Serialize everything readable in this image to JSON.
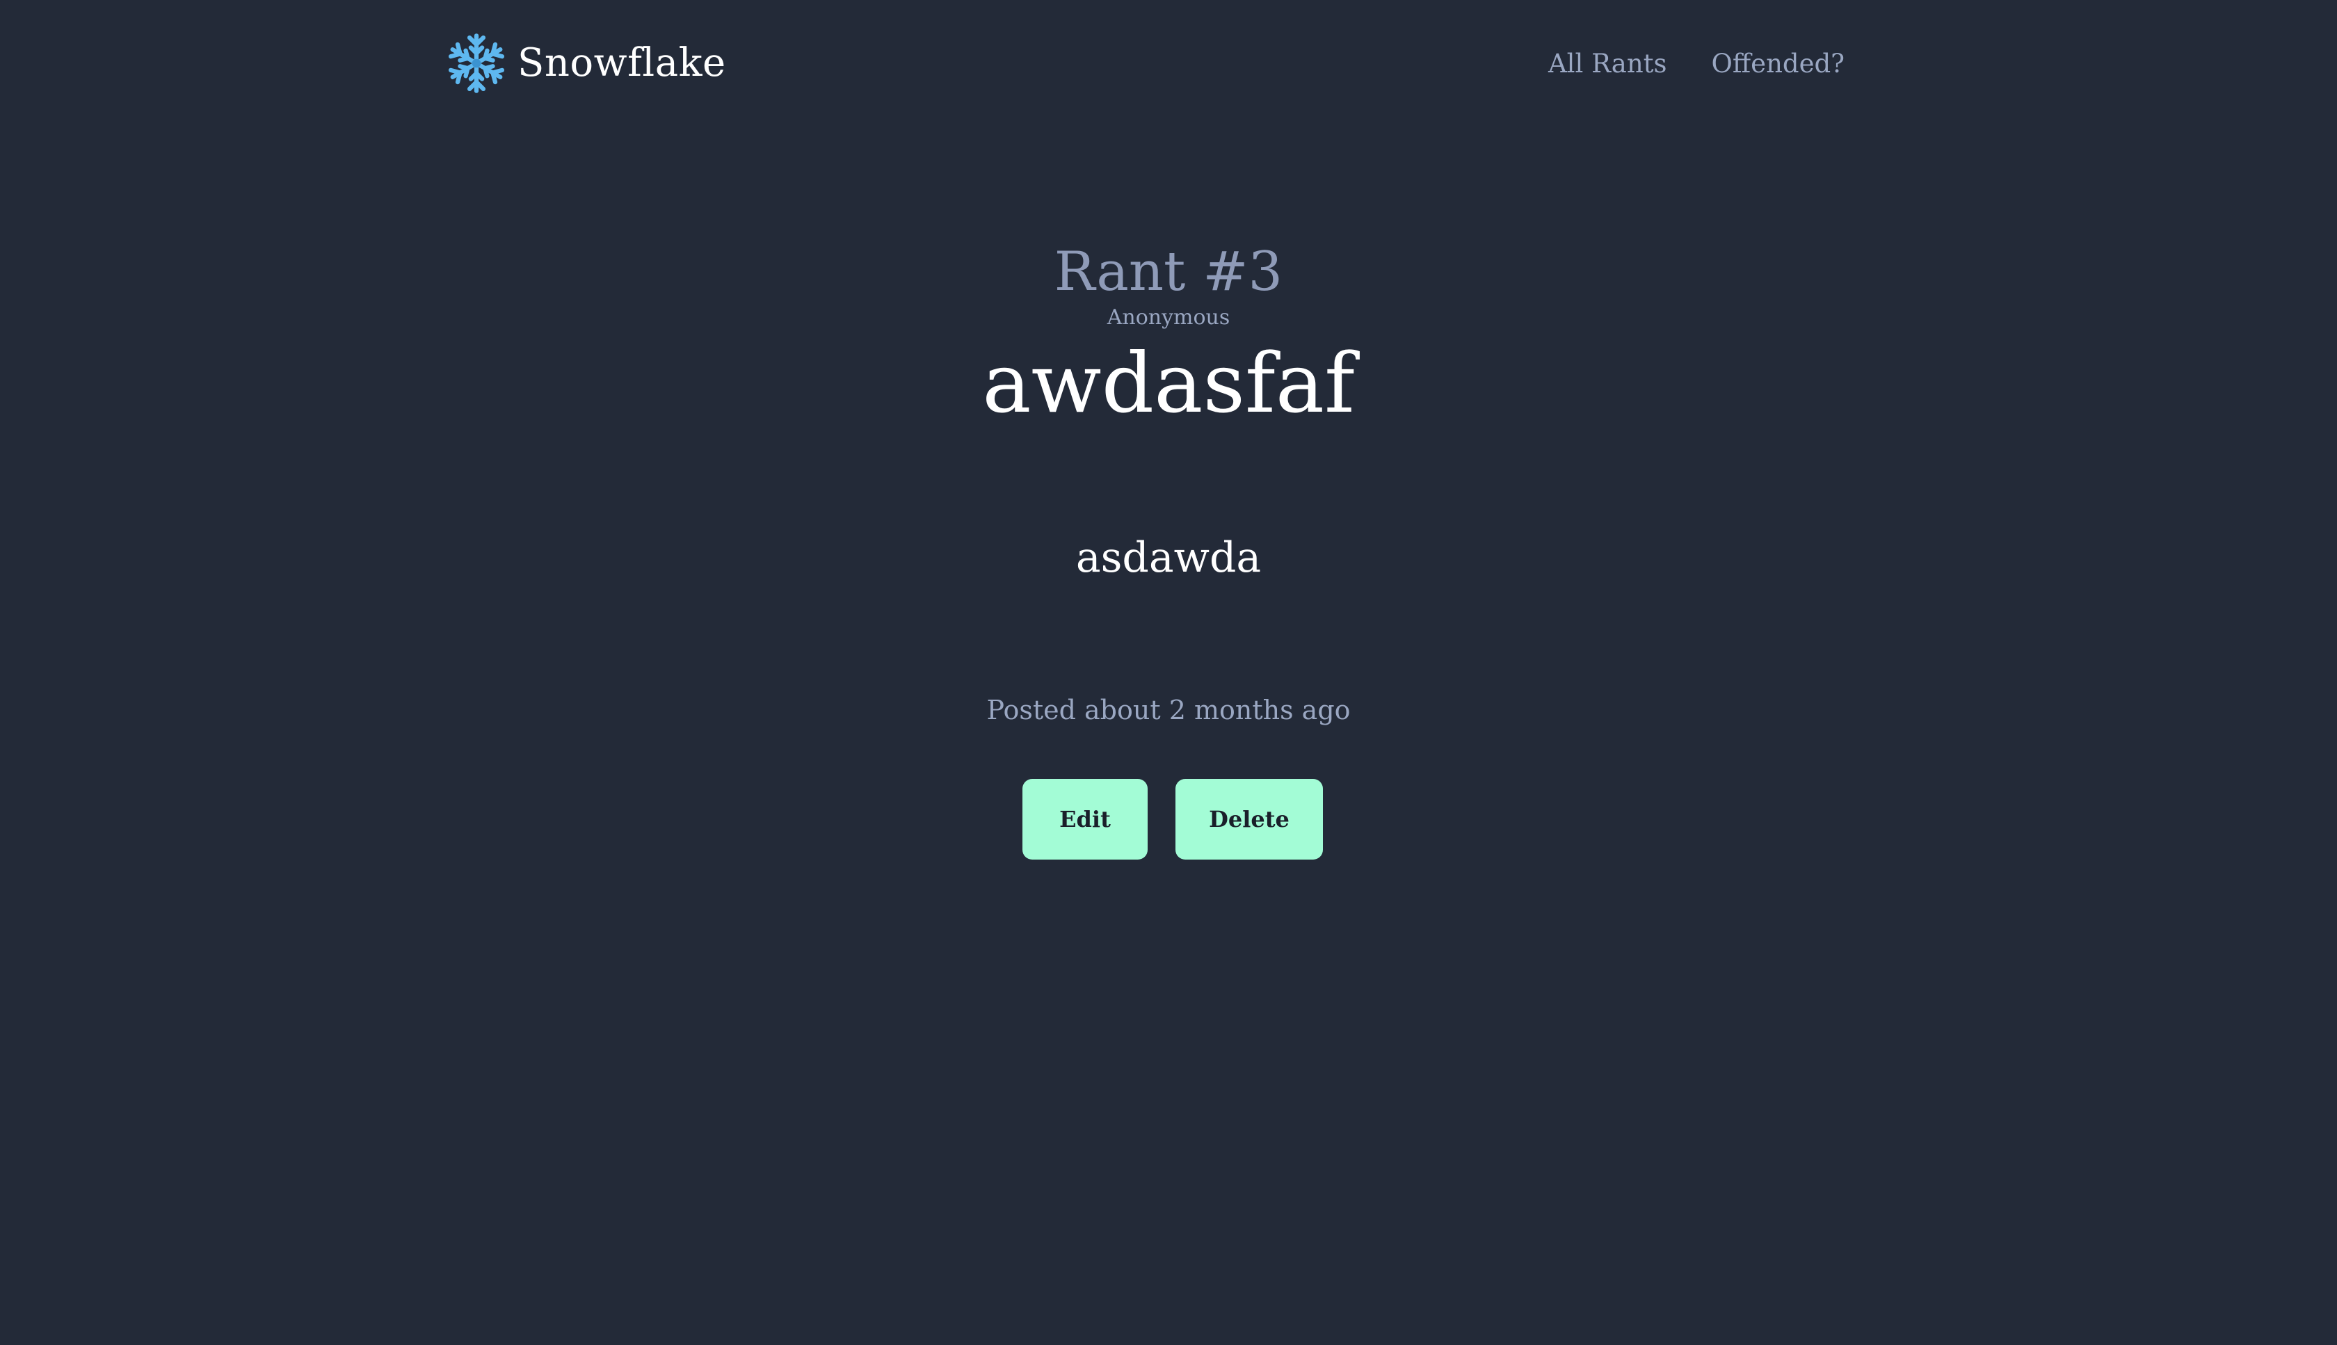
{
  "header": {
    "brand_name": "Snowflake",
    "brand_icon": "snowflake-icon",
    "brand_icon_color": "#5eb8f0",
    "nav": [
      {
        "label": "All Rants"
      },
      {
        "label": "Offended?"
      }
    ]
  },
  "rant": {
    "number_label": "Rant #3",
    "author": "Anonymous",
    "title": "awdasfaf",
    "body": "asdawda",
    "posted": "Posted about 2 months ago"
  },
  "actions": {
    "edit_label": "Edit",
    "delete_label": "Delete"
  },
  "colors": {
    "background": "#232a38",
    "button": "#a3fcd6",
    "muted_text": "#9aa7c2"
  }
}
